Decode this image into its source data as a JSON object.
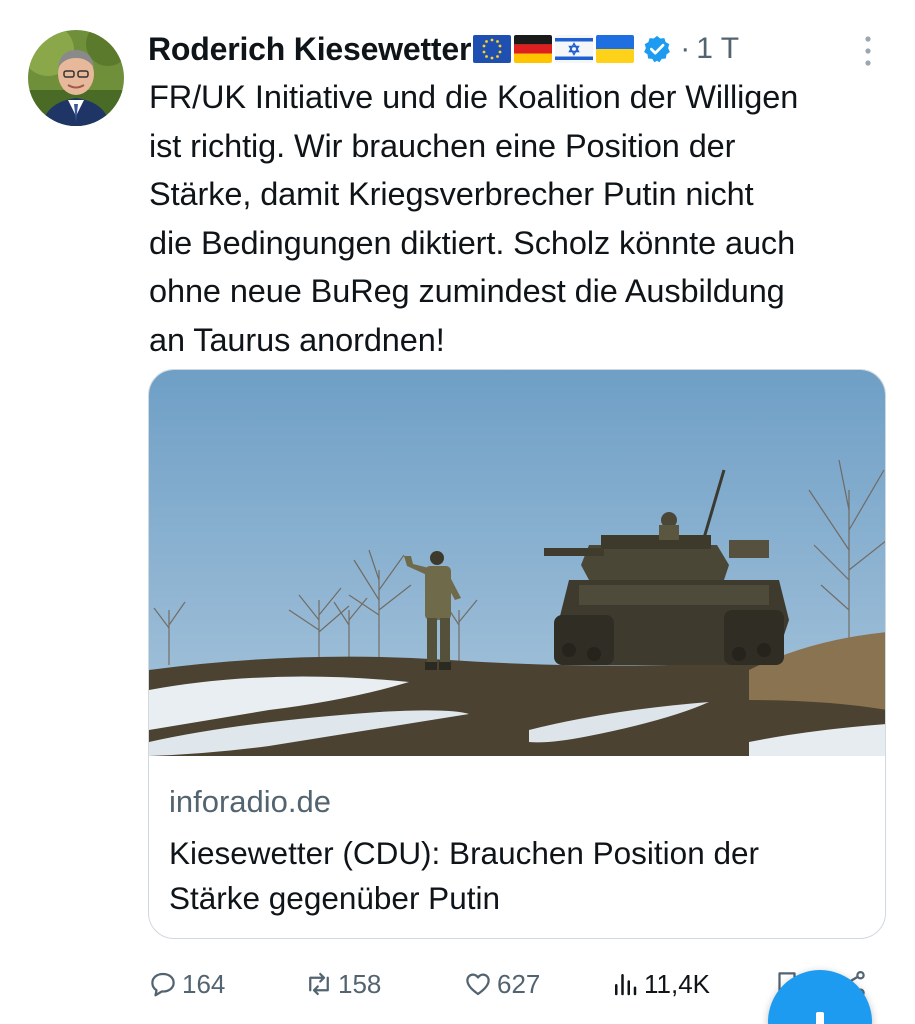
{
  "post": {
    "author": {
      "name": "Roderich Kiesewetter",
      "flags": [
        "eu-flag",
        "germany-flag",
        "israel-flag",
        "ukraine-flag"
      ],
      "verified_icon": "verified-badge-icon",
      "separator": "·",
      "time": "1 T"
    },
    "text": "FR/UK Initiative und die Koalition der Willigen\nist richtig. Wir brauchen eine Position der\nStärke, damit Kriegsverbrecher Putin nicht\ndie Bedingungen diktiert. Scholz könnte auch\nohne neue BuReg zumindest die Ausbildung\nan Taurus anordnen!",
    "card": {
      "domain": "inforadio.de",
      "title": "Kiesewetter (CDU): Brauchen Position der\nStärke gegenüber Putin"
    },
    "actions": {
      "replies": "164",
      "reposts": "158",
      "likes": "627",
      "views": "11,4K"
    }
  },
  "colors": {
    "text_primary": "#0f1419",
    "text_secondary": "#536471",
    "accent": "#1d9bf0",
    "border": "#cfd9de"
  }
}
